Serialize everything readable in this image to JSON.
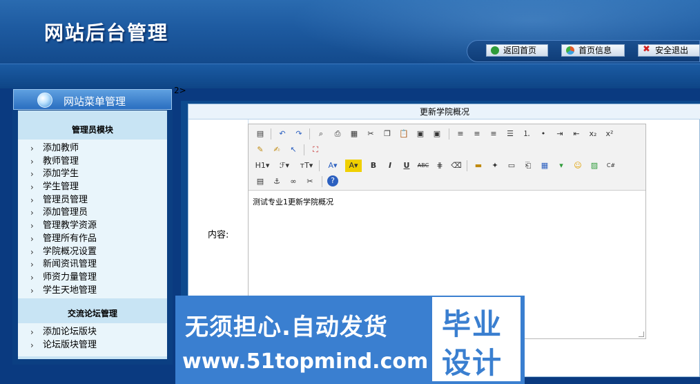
{
  "header": {
    "title": "网站后台管理",
    "buttons": [
      {
        "label": "返回首页",
        "icon": "home-icon",
        "color": "#2e9b3a"
      },
      {
        "label": "首页信息",
        "icon": "pie-chart-icon",
        "color": "#e05a2a"
      },
      {
        "label": "安全退出",
        "icon": "close-icon",
        "color": "#d02020"
      }
    ]
  },
  "sidebar": {
    "title": "网站菜单管理",
    "modules": [
      {
        "title": "管理员模块",
        "items": [
          "添加教师",
          "教师管理",
          "添加学生",
          "学生管理",
          "管理员管理",
          "添加管理员",
          "管理教学资源",
          "管理所有作品",
          "学院概况设置",
          "新闻资讯管理",
          "师资力量管理",
          "学生天地管理"
        ]
      },
      {
        "title": "交流论坛管理",
        "items": [
          "添加论坛版块",
          "论坛版块管理"
        ]
      }
    ]
  },
  "main": {
    "stray_text": "2>",
    "panel_title": "更新学院概况",
    "content_label": "内容:",
    "editor_text": "测试专业1更新学院概况"
  },
  "watermark": {
    "line1": "无须担心.自动发货",
    "line2": "www.51topmind.com",
    "box_line1": "毕业",
    "box_line2": "设计"
  }
}
